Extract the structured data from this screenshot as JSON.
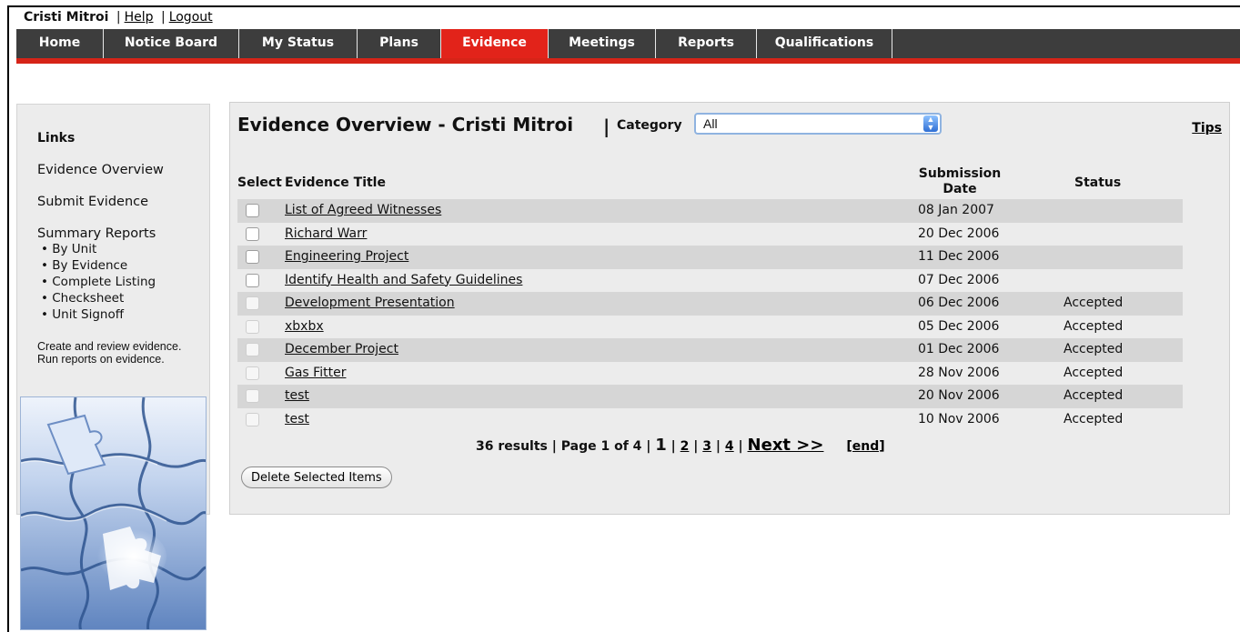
{
  "user": {
    "name": "Cristi Mitroi",
    "help": "Help",
    "logout": "Logout"
  },
  "nav": [
    {
      "label": "Home",
      "width": 96
    },
    {
      "label": "Notice Board",
      "width": 149
    },
    {
      "label": "My Status",
      "width": 130
    },
    {
      "label": "Plans",
      "width": 92
    },
    {
      "label": "Evidence",
      "width": 118,
      "active": true
    },
    {
      "label": "Meetings",
      "width": 118
    },
    {
      "label": "Reports",
      "width": 111
    },
    {
      "label": "Qualifications",
      "width": 149
    }
  ],
  "sidebar": {
    "heading": "Links",
    "overview": "Evidence Overview",
    "submit": "Submit Evidence",
    "summary": "Summary Reports",
    "subs": [
      "• By Unit",
      "• By Evidence",
      "• Complete Listing",
      "• Checksheet",
      "• Unit Signoff"
    ],
    "description": "Create and review evidence. Run reports on evidence."
  },
  "panel": {
    "title": "Evidence Overview - Cristi Mitroi",
    "separator": "|",
    "category_label": "Category",
    "category_value": "All",
    "tips": "Tips",
    "headers": {
      "select": "Select",
      "title": "Evidence Title",
      "date_line1": "Submission",
      "date_line2": "Date",
      "status": "Status"
    },
    "rows": [
      {
        "title": "List of Agreed Witnesses",
        "date": "08 Jan 2007",
        "status": ""
      },
      {
        "title": "Richard Warr",
        "date": "20 Dec 2006",
        "status": ""
      },
      {
        "title": "Engineering Project",
        "date": "11 Dec 2006",
        "status": ""
      },
      {
        "title": "Identify Health and Safety Guidelines",
        "date": "07 Dec 2006",
        "status": ""
      },
      {
        "title": "Development Presentation",
        "date": "06 Dec 2006",
        "status": "Accepted"
      },
      {
        "title": "xbxbx",
        "date": "05 Dec 2006",
        "status": "Accepted"
      },
      {
        "title": "December Project",
        "date": "01 Dec 2006",
        "status": "Accepted"
      },
      {
        "title": "Gas Fitter",
        "date": "28 Nov 2006",
        "status": "Accepted"
      },
      {
        "title": "test",
        "date": "20 Nov 2006",
        "status": "Accepted"
      },
      {
        "title": "test",
        "date": "10 Nov 2006",
        "status": "Accepted"
      }
    ],
    "pager": {
      "summary": "36 results | Page 1 of 4 |",
      "current": "1",
      "pages": [
        "2",
        "3",
        "4"
      ],
      "next": "Next >>",
      "end": "[end]"
    },
    "delete_label": "Delete Selected Items"
  }
}
